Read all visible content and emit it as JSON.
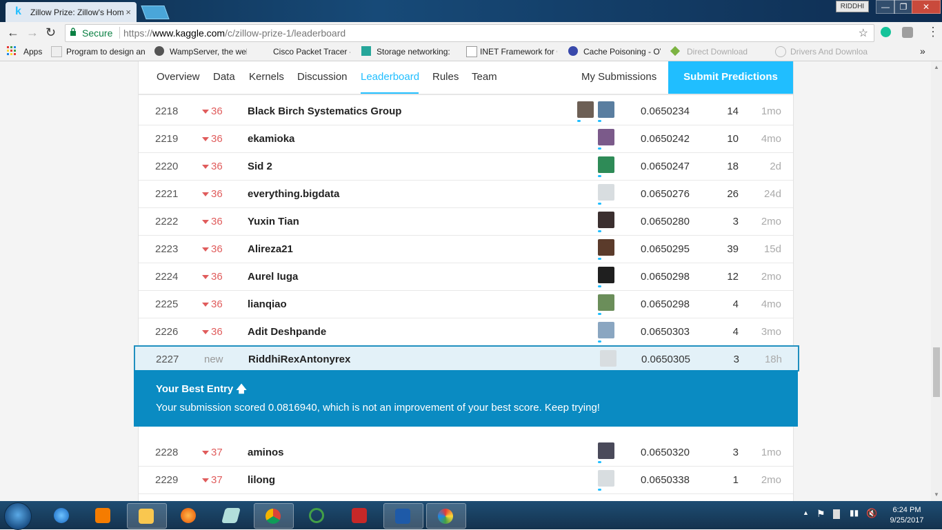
{
  "browser": {
    "tab_title": "Zillow Prize: Zillow's Hom",
    "tab_close": "×",
    "user_badge": "RIDDHI",
    "secure_label": "Secure",
    "url_prefix": "https://",
    "url_host": "www.kaggle.com",
    "url_path": "/c/zillow-prize-1/leaderboard",
    "window_buttons": [
      "—",
      "❐",
      "✕"
    ]
  },
  "bookmarks": [
    {
      "label": "Apps"
    },
    {
      "label": "Program to design an"
    },
    {
      "label": "WampServer, the web"
    },
    {
      "label": "Cisco Packet Tracer -"
    },
    {
      "label": "Storage networking:"
    },
    {
      "label": "INET Framework for C"
    },
    {
      "label": "Cache Poisoning - OV"
    },
    {
      "label": "Direct Download"
    },
    {
      "label": "Drivers And Downloa"
    }
  ],
  "nav": {
    "overview": "Overview",
    "data": "Data",
    "kernels": "Kernels",
    "discussion": "Discussion",
    "leaderboard": "Leaderboard",
    "rules": "Rules",
    "team": "Team",
    "my_submissions": "My Submissions",
    "submit": "Submit Predictions"
  },
  "leaderboard": {
    "rows_before": [
      {
        "rank": "2218",
        "change": "36",
        "team": "Black Birch Systematics Group",
        "score": "0.0650234",
        "entries": "14",
        "last": "1mo"
      },
      {
        "rank": "2219",
        "change": "36",
        "team": "ekamioka",
        "score": "0.0650242",
        "entries": "10",
        "last": "4mo"
      },
      {
        "rank": "2220",
        "change": "36",
        "team": "Sid 2",
        "score": "0.0650247",
        "entries": "18",
        "last": "2d"
      },
      {
        "rank": "2221",
        "change": "36",
        "team": "everything.bigdata",
        "score": "0.0650276",
        "entries": "26",
        "last": "24d"
      },
      {
        "rank": "2222",
        "change": "36",
        "team": "Yuxin Tian",
        "score": "0.0650280",
        "entries": "3",
        "last": "2mo"
      },
      {
        "rank": "2223",
        "change": "36",
        "team": "Alireza21",
        "score": "0.0650295",
        "entries": "39",
        "last": "15d"
      },
      {
        "rank": "2224",
        "change": "36",
        "team": "Aurel Iuga",
        "score": "0.0650298",
        "entries": "12",
        "last": "2mo"
      },
      {
        "rank": "2225",
        "change": "36",
        "team": "lianqiao",
        "score": "0.0650298",
        "entries": "4",
        "last": "4mo"
      },
      {
        "rank": "2226",
        "change": "36",
        "team": "Adit Deshpande",
        "score": "0.0650303",
        "entries": "4",
        "last": "3mo"
      }
    ],
    "my_row": {
      "rank": "2227",
      "change": "new",
      "team": "RiddhiRexAntonyrex",
      "score": "0.0650305",
      "entries": "3",
      "last": "18h"
    },
    "best_entry": {
      "title": "Your Best Entry",
      "message": "Your submission scored 0.0816940, which is not an improvement of your best score. Keep trying!"
    },
    "rows_after": [
      {
        "rank": "2228",
        "change": "37",
        "team": "aminos",
        "score": "0.0650320",
        "entries": "3",
        "last": "1mo"
      },
      {
        "rank": "2229",
        "change": "37",
        "team": "lilong",
        "score": "0.0650338",
        "entries": "1",
        "last": "2mo"
      }
    ]
  },
  "taskbar": {
    "time": "6:24 PM",
    "date": "9/25/2017"
  },
  "colors": {
    "accent": "#20beff",
    "best_box": "#0a8bc2",
    "drop": "#e05c5c"
  }
}
